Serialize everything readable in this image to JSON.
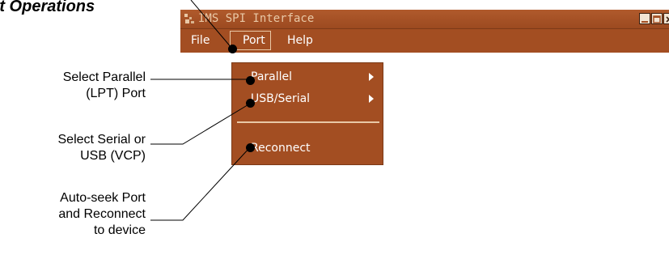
{
  "heading": "Port Operations",
  "window": {
    "title": "IMS SPI Interface",
    "icon": "app-icon",
    "controls": [
      "minimize-icon",
      "maximize-icon",
      "close-icon"
    ]
  },
  "menubar": {
    "items": [
      {
        "label": "File"
      },
      {
        "label": "Port"
      },
      {
        "label": "Help"
      }
    ]
  },
  "port_menu": {
    "items": [
      {
        "label": "Parallel",
        "submenu": true
      },
      {
        "label": "USB/Serial",
        "submenu": true
      },
      {
        "label": "Reconnect",
        "submenu": false
      }
    ]
  },
  "callouts": [
    {
      "lines": [
        "Select Parallel",
        "(LPT) Port"
      ]
    },
    {
      "lines": [
        "Select Serial or",
        "USB (VCP)"
      ]
    },
    {
      "lines": [
        "Auto-seek Port",
        "and Reconnect",
        "to device"
      ]
    }
  ],
  "colors": {
    "menu_bg": "#a34e22",
    "menu_text": "#ffffff",
    "title_text": "#e9c8a6",
    "separator": "#e9c8a6"
  }
}
